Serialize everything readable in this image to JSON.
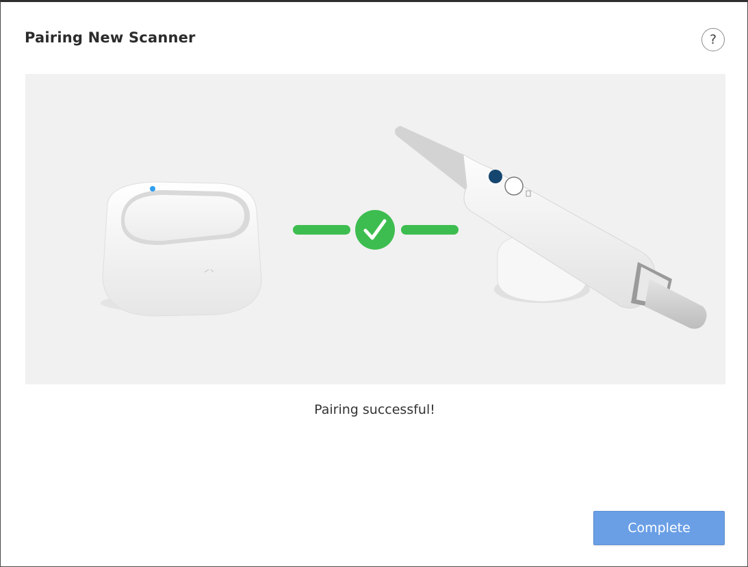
{
  "dialog": {
    "title": "Pairing New Scanner",
    "help_label": "?",
    "status_message": "Pairing successful!",
    "complete_label": "Complete"
  },
  "illustration": {
    "left_device": "hub-device",
    "center_icon": "check-icon",
    "right_device": "intraoral-scanner",
    "link_color": "#3dbd4f",
    "background": "#f1f1f1"
  },
  "colors": {
    "accent_button": "#6a9fe6",
    "success": "#3dbd4f"
  }
}
